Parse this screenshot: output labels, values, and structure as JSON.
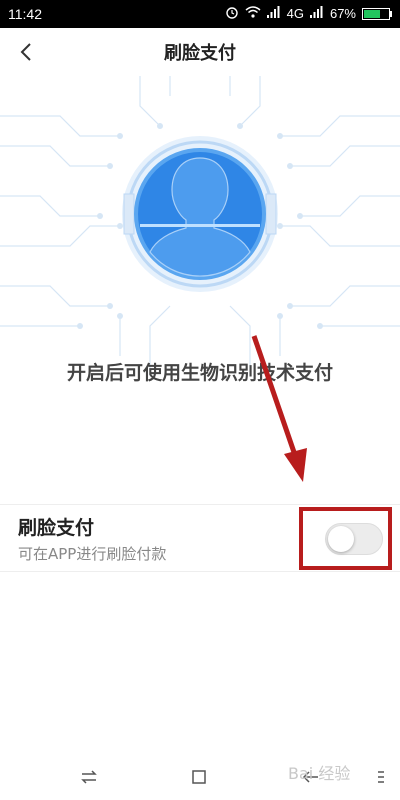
{
  "status_bar": {
    "time": "11:42",
    "network": "4G",
    "battery": "67%",
    "battery_level": 0.67
  },
  "header": {
    "title": "刷脸支付"
  },
  "hero": {
    "description": "开启后可使用生物识别技术支付"
  },
  "setting": {
    "title": "刷脸支付",
    "subtitle": "可在APP进行刷脸付款",
    "enabled": false
  },
  "watermark": {
    "text": "Bai 经验"
  },
  "colors": {
    "accent_blue": "#2f86e6",
    "highlight_red": "#b81d1d"
  },
  "icons": {
    "back": "chevron-left-icon",
    "face": "face-scan-icon",
    "nav_recent": "swap-icon",
    "nav_home": "square-icon",
    "nav_back": "arrow-left-icon",
    "nav_menu": "menu-icon"
  }
}
